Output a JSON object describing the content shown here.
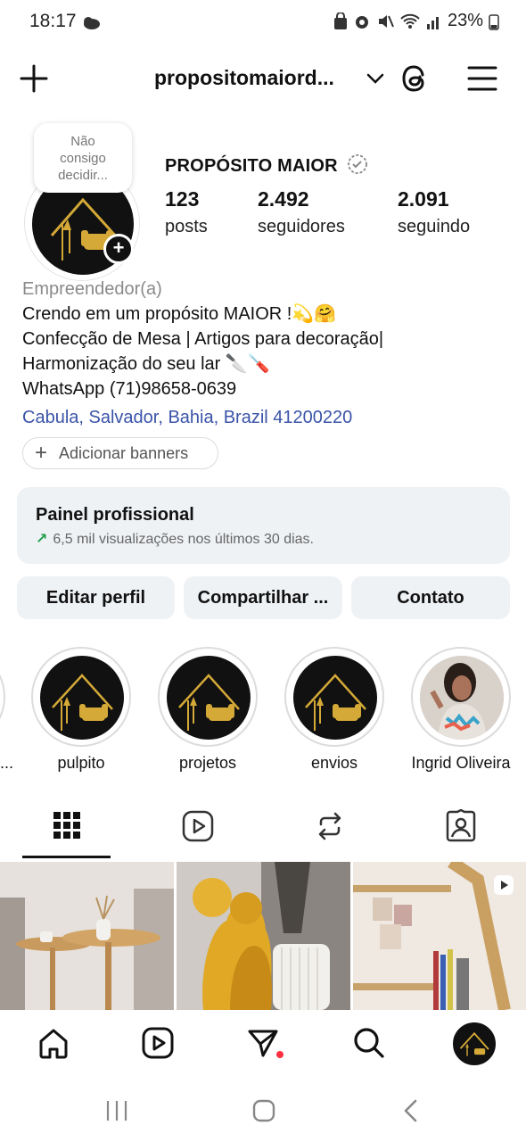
{
  "status_bar": {
    "time": "18:17",
    "battery": "23%"
  },
  "header": {
    "username": "propositomaiord...",
    "icons": [
      "plus-icon",
      "chevron-down-icon",
      "threads-icon",
      "menu-icon"
    ]
  },
  "profile": {
    "note": "Não consigo decidir...",
    "display_name": "PROPÓSITO MAIOR",
    "stats": [
      {
        "value": "123",
        "label": "posts"
      },
      {
        "value": "2.492",
        "label": "seguidores"
      },
      {
        "value": "2.091",
        "label": "seguindo"
      }
    ],
    "category": "Empreendedor(a)",
    "bio_lines": [
      "Crendo em um propósito MAIOR !💫🤗",
      "Confecção de Mesa | Artigos para decoração|",
      "Harmonização do seu lar 🔪🪛",
      "WhatsApp (71)98658-0639"
    ],
    "location": "Cabula, Salvador, Bahia, Brazil 41200220",
    "add_banners": "Adicionar banners"
  },
  "dashboard": {
    "title": "Painel profissional",
    "subtitle": "6,5 mil visualizações nos últimos 30 dias."
  },
  "actions": {
    "edit": "Editar perfil",
    "share": "Compartilhar ...",
    "contact": "Contato"
  },
  "highlights": [
    {
      "label": "..."
    },
    {
      "label": "pulpito"
    },
    {
      "label": "projetos"
    },
    {
      "label": "envios"
    },
    {
      "label": "Ingrid Oliveira"
    }
  ],
  "tabs": [
    "grid-icon",
    "reels-icon",
    "reposts-icon",
    "tagged-icon"
  ],
  "bottom_nav": [
    "home-icon",
    "reels-icon",
    "send-icon",
    "search-icon",
    "profile-icon"
  ],
  "colors": {
    "accent_link": "#3a54a8",
    "panel_bg": "#eff2f5",
    "gold": "#d4a937",
    "trend_green": "#1e9e4a",
    "notification": "#ff3040"
  }
}
